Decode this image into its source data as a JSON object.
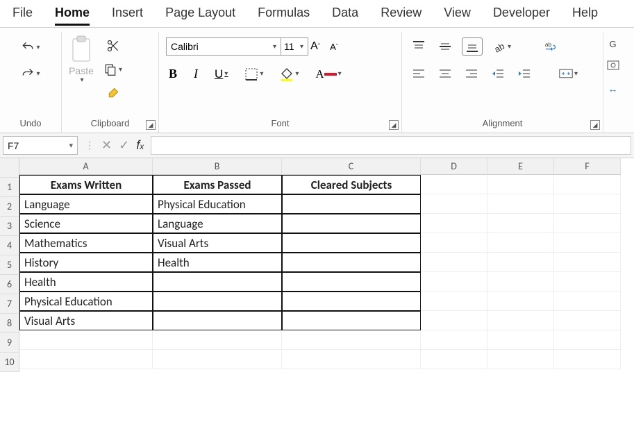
{
  "menu": {
    "items": [
      "File",
      "Home",
      "Insert",
      "Page Layout",
      "Formulas",
      "Data",
      "Review",
      "View",
      "Developer",
      "Help"
    ],
    "active_index": 1
  },
  "ribbon": {
    "undo_group": "Undo",
    "clipboard_group": "Clipboard",
    "paste_label": "Paste",
    "font_group": "Font",
    "font_name": "Calibri",
    "font_size": "11",
    "alignment_group": "Alignment"
  },
  "formula_bar": {
    "namebox": "F7",
    "fx": ""
  },
  "sheet": {
    "columns": [
      "A",
      "B",
      "C",
      "D",
      "E",
      "F"
    ],
    "row_count": 10,
    "headers": [
      "Exams Written",
      "Exams Passed",
      "Cleared Subjects"
    ],
    "col_a": [
      "Language",
      "Science",
      "Mathematics",
      "History",
      "Health",
      "Physical Education",
      "Visual Arts"
    ],
    "col_b": [
      "Physical Education",
      "Language",
      "Visual Arts",
      "Health",
      "",
      "",
      ""
    ]
  },
  "chart_data": {
    "type": "table",
    "title": "",
    "columns": [
      "Exams Written",
      "Exams Passed",
      "Cleared Subjects"
    ],
    "rows": [
      [
        "Language",
        "Physical Education",
        ""
      ],
      [
        "Science",
        "Language",
        ""
      ],
      [
        "Mathematics",
        "Visual Arts",
        ""
      ],
      [
        "History",
        "Health",
        ""
      ],
      [
        "Health",
        "",
        ""
      ],
      [
        "Physical Education",
        "",
        ""
      ],
      [
        "Visual Arts",
        "",
        ""
      ]
    ]
  }
}
